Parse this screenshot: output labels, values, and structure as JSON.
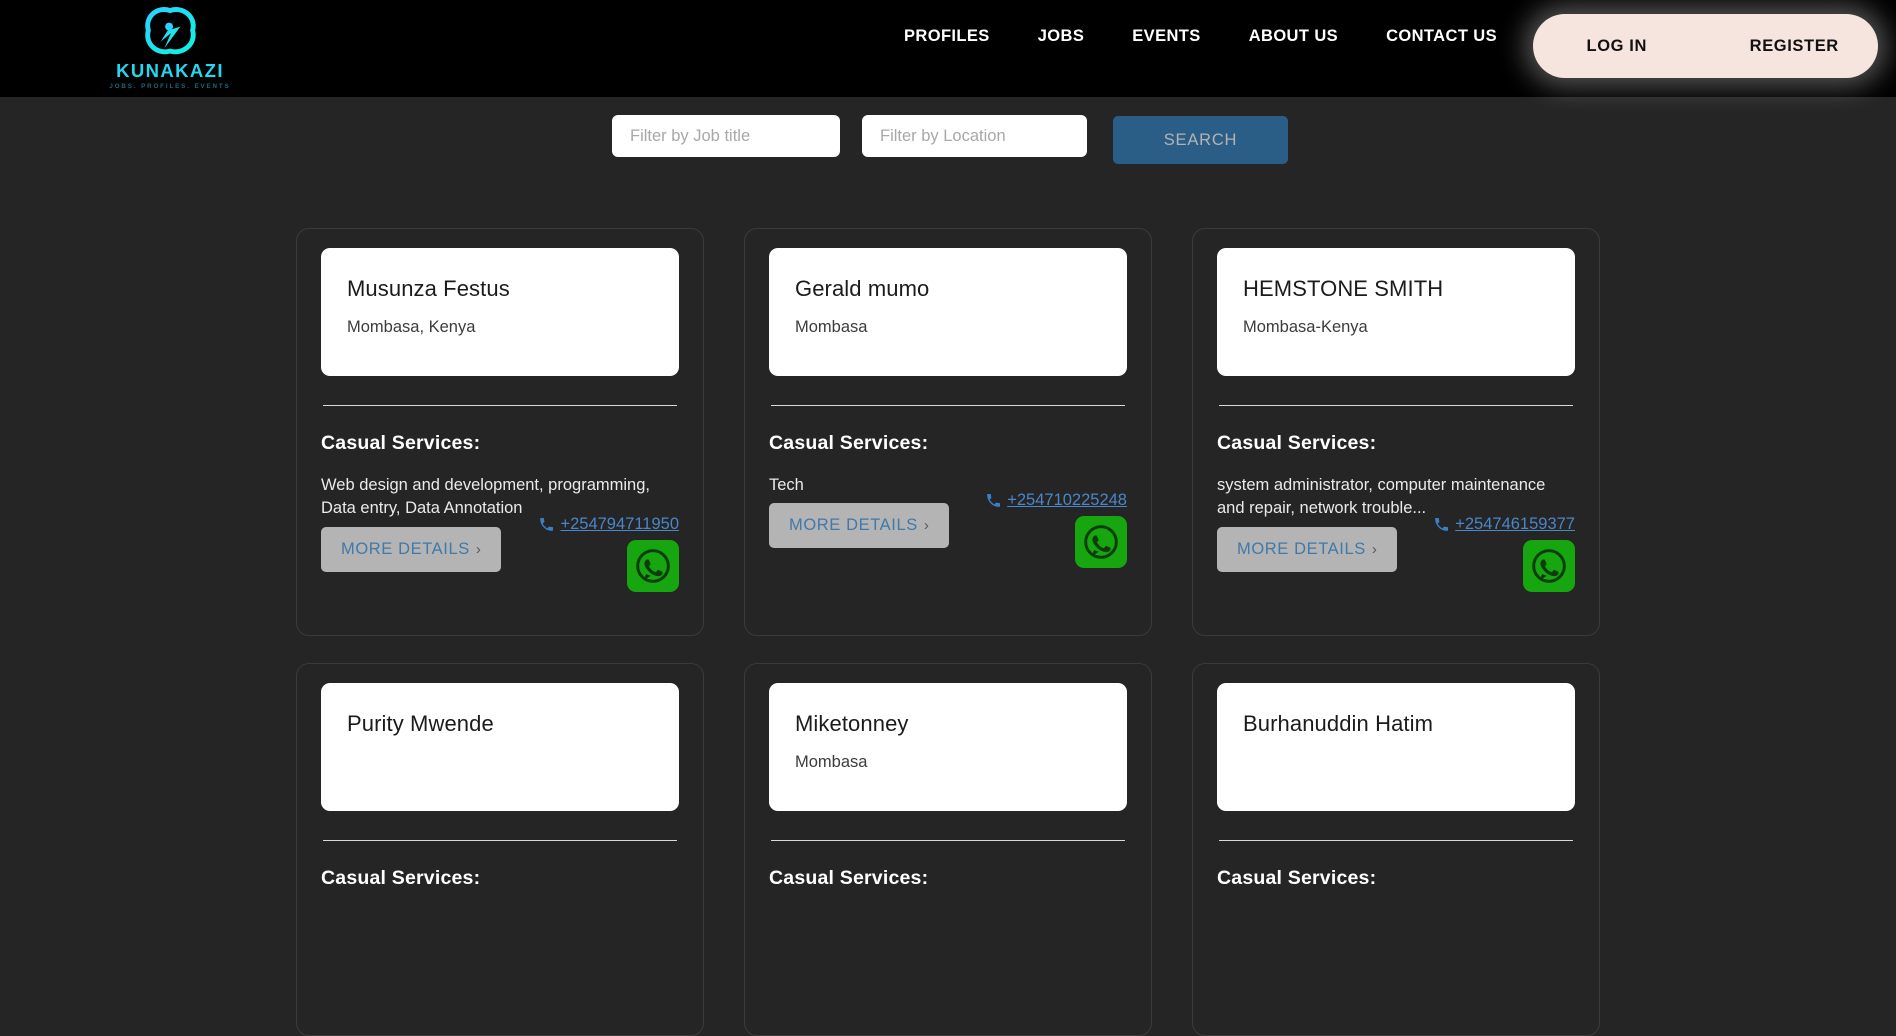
{
  "header": {
    "logo": {
      "icon": "kunakazi-atom-logo",
      "wordmark": "KUNAKAZI",
      "tagline": "JOBS. PROFILES. EVENTS",
      "color": "#22d8f0"
    },
    "nav": [
      {
        "label": "PROFILES"
      },
      {
        "label": "JOBS"
      },
      {
        "label": "EVENTS"
      },
      {
        "label": "ABOUT US"
      },
      {
        "label": "CONTACT US"
      }
    ],
    "auth": {
      "login_label": "LOG IN",
      "register_label": "REGISTER",
      "pill_color": "#f6e5de"
    },
    "background": "#000000"
  },
  "search": {
    "job_placeholder": "Filter by Job title",
    "job_value": "",
    "location_placeholder": "Filter by Location",
    "location_value": "",
    "button_label": "SEARCH",
    "button_color": "#2b5e87"
  },
  "labels": {
    "services_heading": "Casual Services:",
    "more_details": "MORE DETAILS",
    "chevron": "›",
    "whatsapp_icon": "whatsapp-icon",
    "phone_icon": "phone-icon"
  },
  "cards": [
    {
      "name": "Musunza Festus",
      "location": "Mombasa, Kenya",
      "services": "Web design and development, programming, Data entry, Data Annotation",
      "phone": "+254794711950",
      "has_contact": true
    },
    {
      "name": "Gerald mumo",
      "location": "Mombasa",
      "services": "Tech",
      "phone": "+254710225248",
      "has_contact": true
    },
    {
      "name": "HEMSTONE SMITH",
      "location": "Mombasa-Kenya",
      "services": "system administrator, computer maintenance and repair, network trouble...",
      "phone": "+254746159377",
      "has_contact": true
    },
    {
      "name": "Purity Mwende",
      "location": "",
      "services": "",
      "phone": "",
      "has_contact": false
    },
    {
      "name": "Miketonney",
      "location": "Mombasa",
      "services": "",
      "phone": "",
      "has_contact": false
    },
    {
      "name": "Burhanuddin Hatim",
      "location": "",
      "services": "",
      "phone": "",
      "has_contact": false
    }
  ],
  "colors": {
    "page_background": "#252525",
    "card_border": "#3b3b3b",
    "link_blue": "#4a86c8",
    "whatsapp_green": "#17a510",
    "more_btn_gray": "#b4b4b4"
  }
}
